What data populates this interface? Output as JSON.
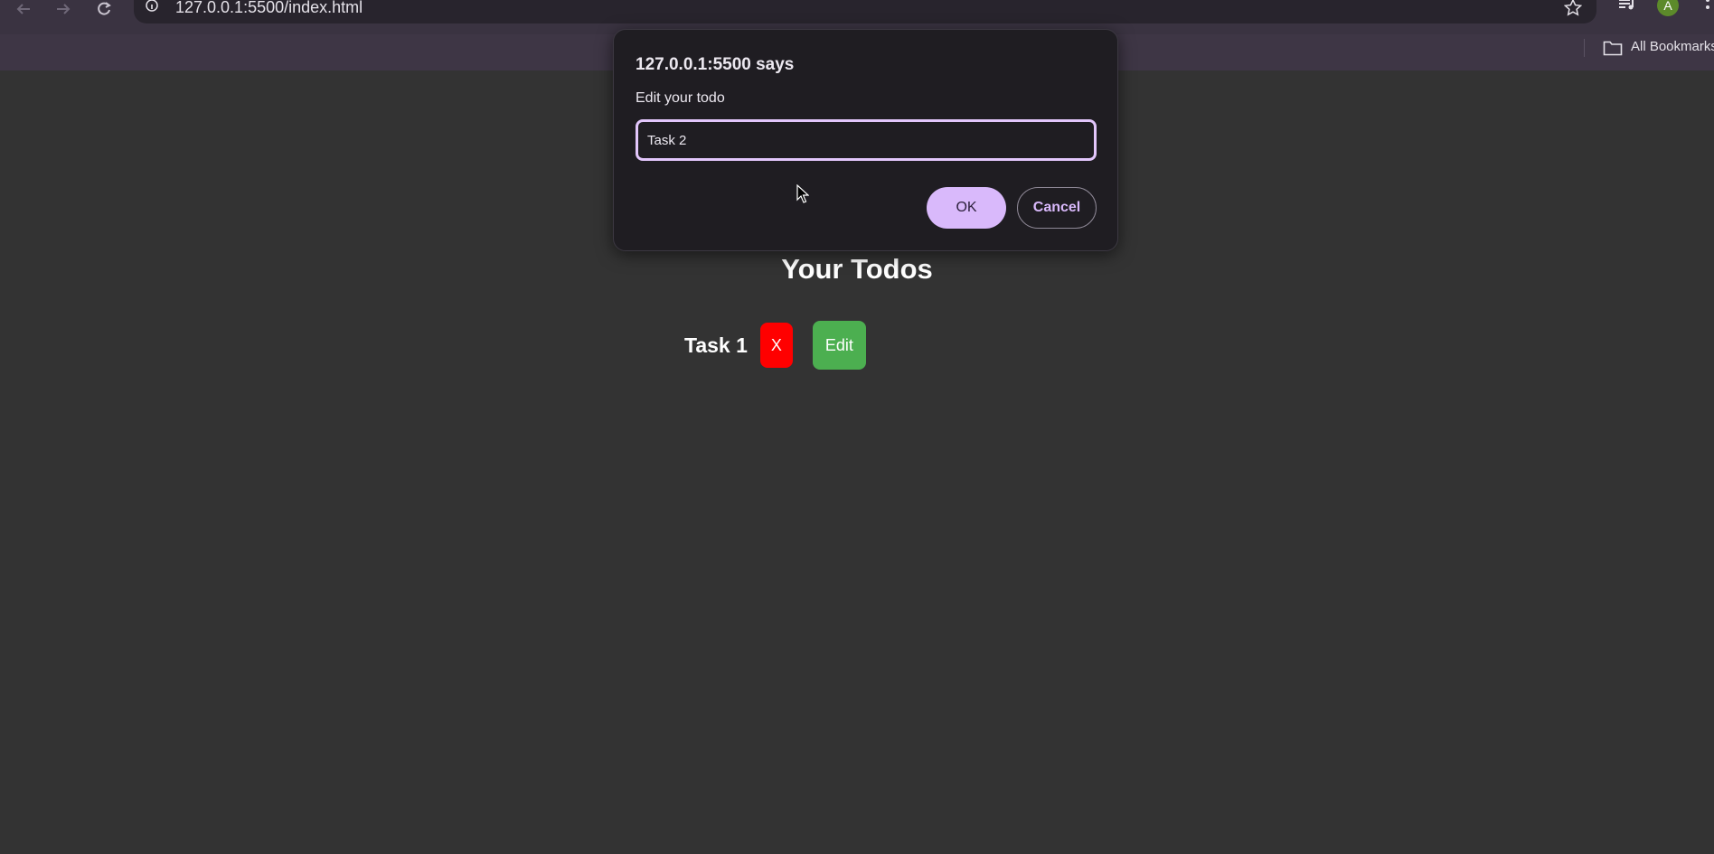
{
  "browser": {
    "url": "127.0.0.1:5500/index.html",
    "bookmarks_label": "All Bookmarks",
    "profile_initial": "A",
    "icons": [
      "back-icon",
      "forward-icon",
      "reload-icon",
      "site-info-icon",
      "bookmark-star-icon",
      "media-icon",
      "profile-avatar",
      "menu-icon",
      "folder-icon"
    ]
  },
  "page": {
    "heading": "Your Todos",
    "todos": [
      {
        "text": "Task 1",
        "delete_label": "X",
        "edit_label": "Edit"
      }
    ]
  },
  "dialog": {
    "title": "127.0.0.1:5500 says",
    "message": "Edit your todo",
    "input_value": "Task 2",
    "ok_label": "OK",
    "cancel_label": "Cancel"
  },
  "colors": {
    "page_background": "#333333",
    "delete_button": "#ff0000",
    "edit_button": "#4caf50",
    "dialog_accent": "#d9b9fb",
    "dialog_background": "#1f1d22"
  }
}
